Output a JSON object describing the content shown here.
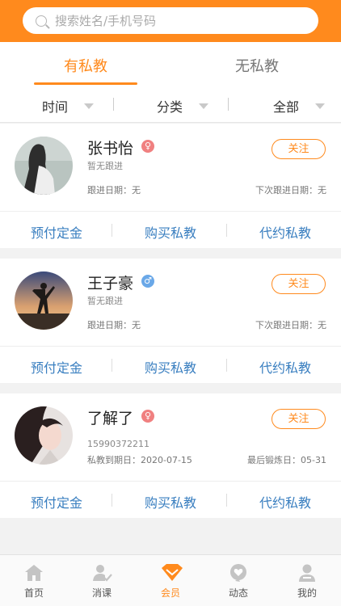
{
  "search": {
    "placeholder": "搜索姓名/手机号码"
  },
  "tabs": [
    {
      "label": "有私教",
      "active": true
    },
    {
      "label": "无私教",
      "active": false
    }
  ],
  "filters": [
    {
      "label": "时间"
    },
    {
      "label": "分类"
    },
    {
      "label": "全部"
    }
  ],
  "colors": {
    "accent": "#ff8a1d",
    "link": "#3a7fc0",
    "female": "#f08080",
    "male": "#6aa8e8"
  },
  "members": [
    {
      "name": "张书怡",
      "gender": "female",
      "gender_icon": "female-icon",
      "follow_label": "关注",
      "line1": "暂无跟进",
      "line2_left": "跟进日期：无",
      "line2_right": "下次跟进日期：无",
      "actions": [
        "预付定金",
        "购买私教",
        "代约私教"
      ]
    },
    {
      "name": "王子豪",
      "gender": "male",
      "gender_icon": "male-icon",
      "follow_label": "关注",
      "line1": "暂无跟进",
      "line2_left": "跟进日期：无",
      "line2_right": "下次跟进日期：无",
      "actions": [
        "预付定金",
        "购买私教",
        "代约私教"
      ]
    },
    {
      "name": "了解了",
      "gender": "female",
      "gender_icon": "female-icon",
      "follow_label": "关注",
      "line1": "15990372211",
      "line2_left": "私教到期日：2020-07-15",
      "line2_right": "最后锻炼日：05-31",
      "actions": [
        "预付定金",
        "购买私教",
        "代约私教"
      ]
    }
  ],
  "bottom_nav": [
    {
      "label": "首页",
      "icon": "home-icon"
    },
    {
      "label": "消课",
      "icon": "user-check-icon"
    },
    {
      "label": "会员",
      "icon": "diamond-icon",
      "active": true
    },
    {
      "label": "动态",
      "icon": "heart-bubble-icon"
    },
    {
      "label": "我的",
      "icon": "profile-icon"
    }
  ]
}
